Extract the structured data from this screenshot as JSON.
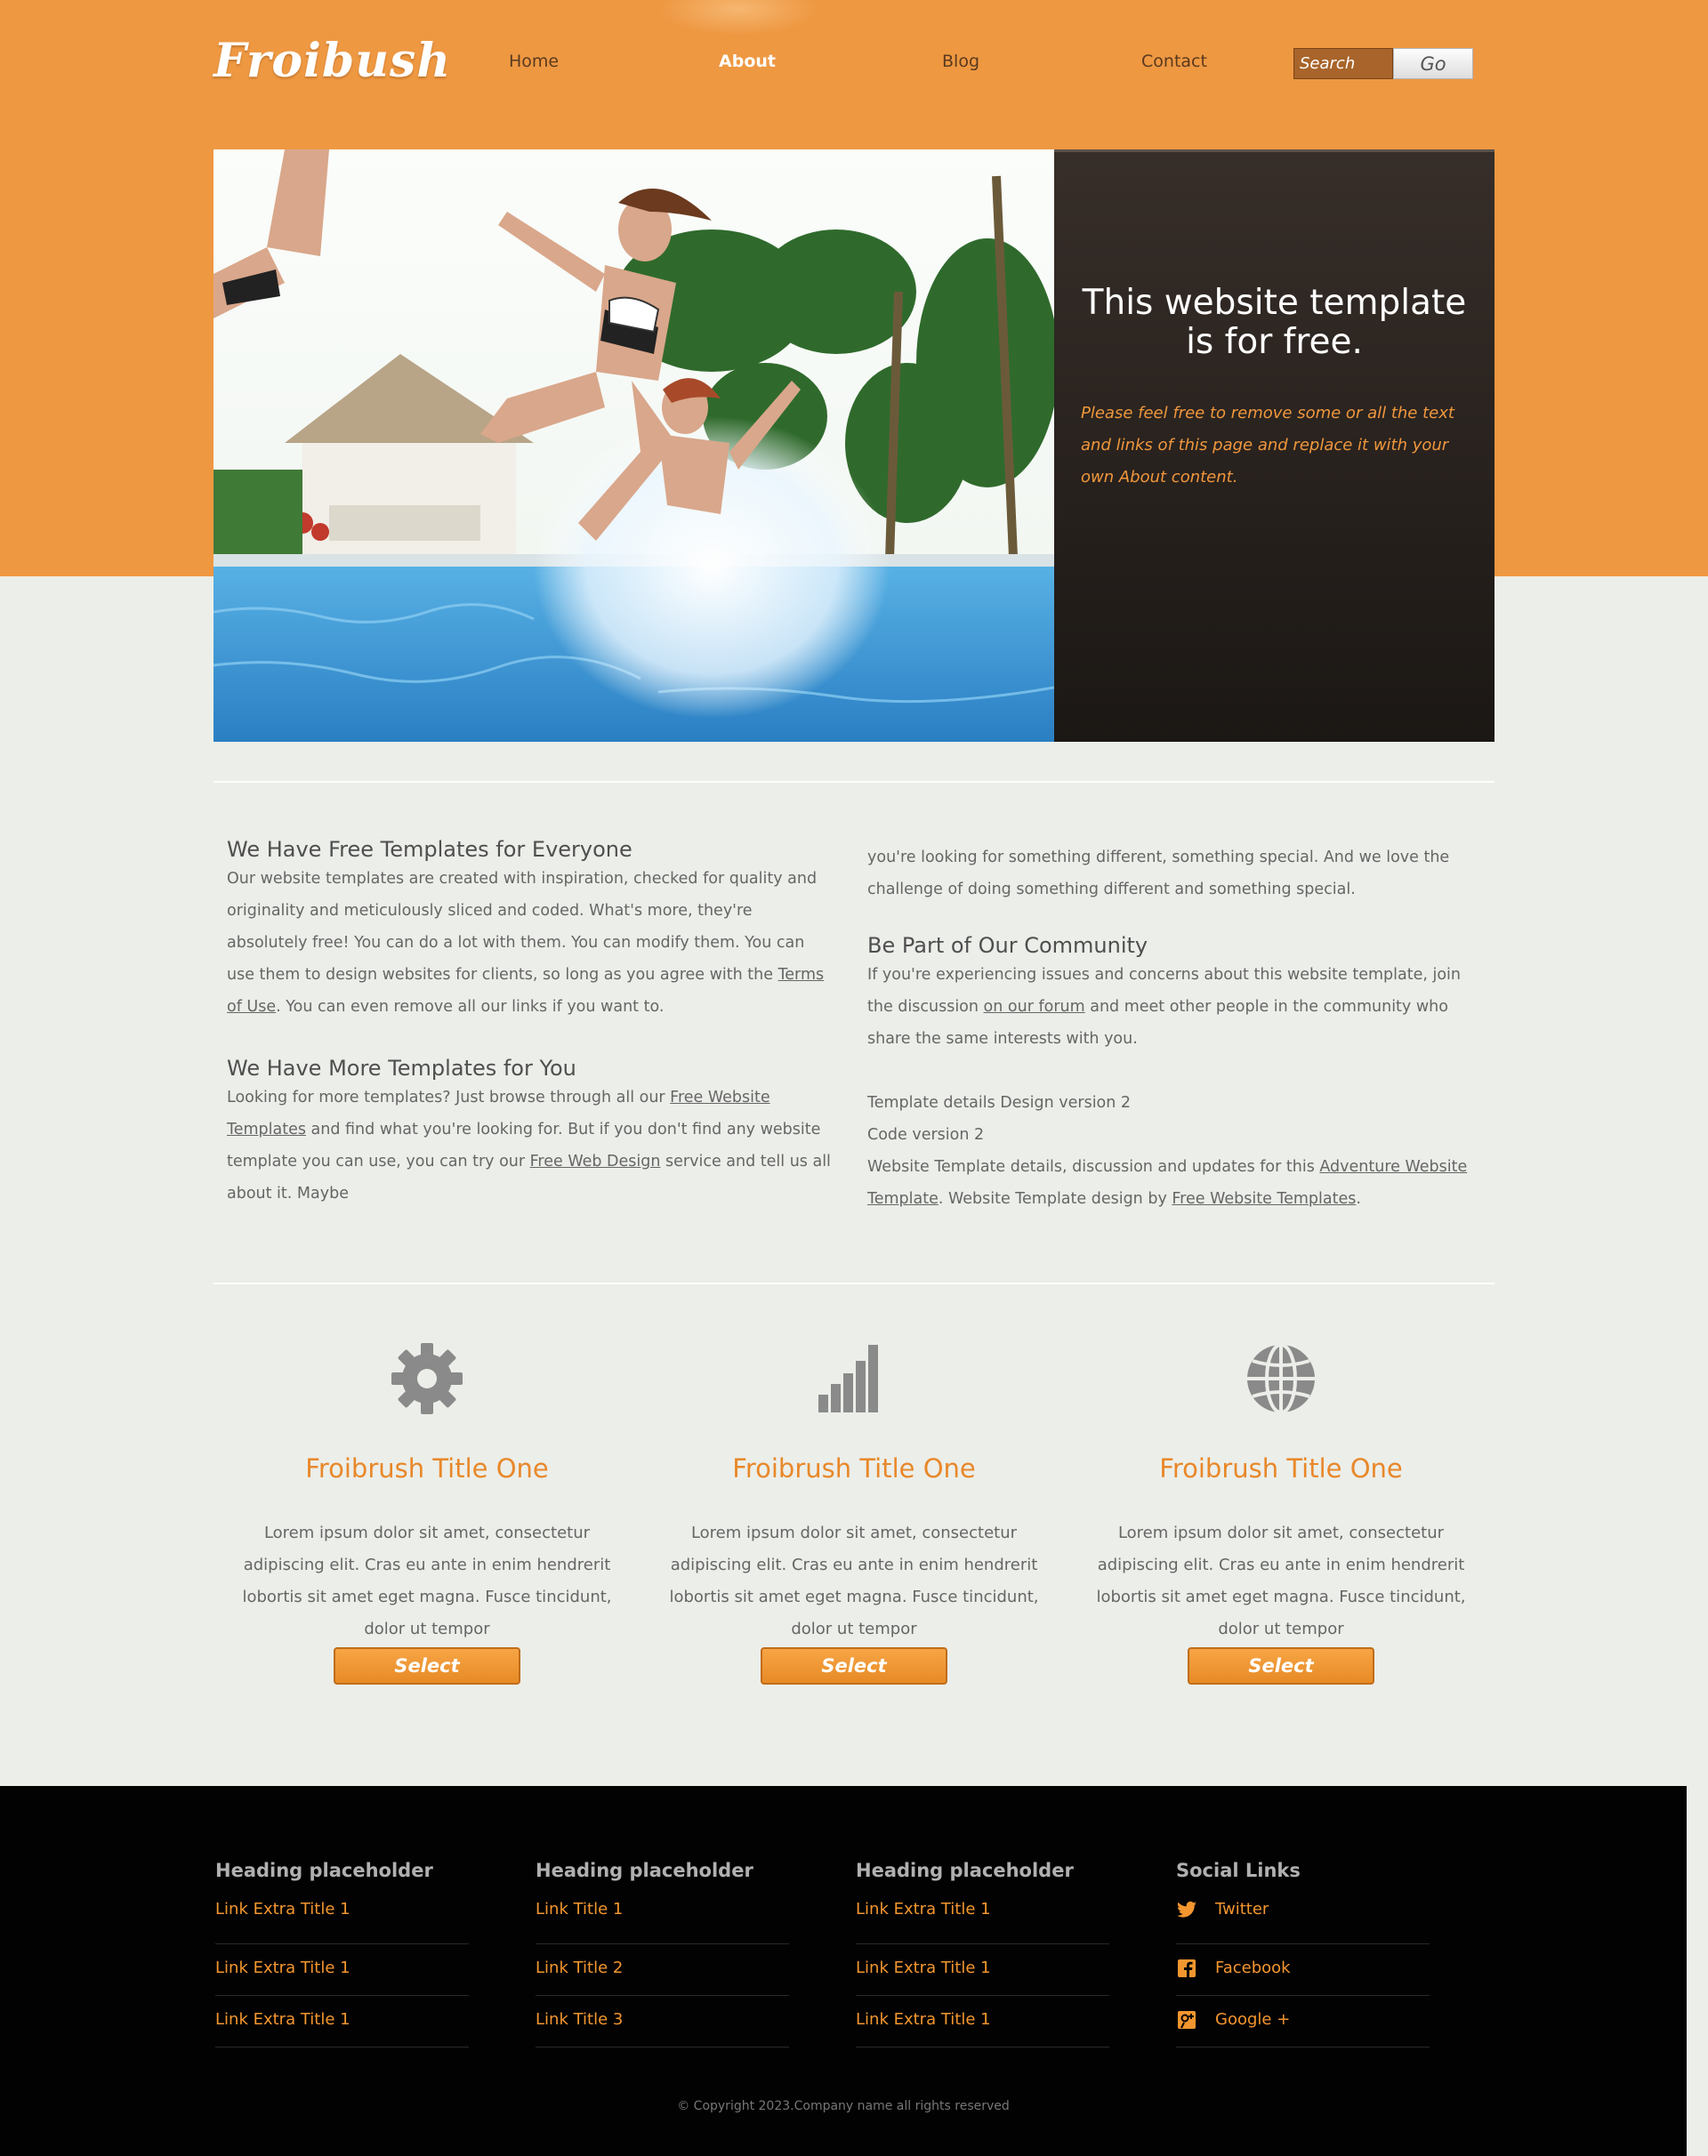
{
  "header": {
    "logo": "Froibush",
    "nav": [
      "Home",
      "About",
      "Blog",
      "Contact"
    ],
    "active_nav": "About",
    "search_placeholder": "Search",
    "search_button": "Go"
  },
  "hero": {
    "title": "This website template is for free.",
    "text": "Please feel free to remove some or all the text and links of this page and replace it with your own About content."
  },
  "content": {
    "left": {
      "h1": "We Have Free Templates for Everyone",
      "p1_a": "Our website templates are created with inspiration, checked for quality and originality and meticulously sliced and coded. What's more, they're absolutely free! You can do a lot with them. You can modify them. You can use them to design websites for clients, so long as you agree with the ",
      "p1_link": "Terms of Use",
      "p1_b": ". You can even remove all our links if you want to.",
      "h2": "We Have More Templates for You",
      "p2_a": "Looking for more templates? Just browse through all our ",
      "p2_link1": "Free Website Templates",
      "p2_b": " and find what you're looking for. But if you don't find any website template you can use, you can try our ",
      "p2_link2": "Free Web Design",
      "p2_c": " service and tell us all about it. Maybe"
    },
    "right": {
      "p0": "you're looking for something different, something special. And we love the challenge of doing something different and something special.",
      "h3": "Be Part of Our Community",
      "p3_a": "If you're experiencing issues and concerns about this website template, join the discussion ",
      "p3_link": "on our forum",
      "p3_b": " and meet other people in the community who share the same interests with you.",
      "d1": "Template details Design version 2",
      "d2": "Code version 2",
      "d3_a": "Website Template details, discussion and updates for this ",
      "d3_link1": "Adventure Website Template",
      "d3_b": ". Website Template design by ",
      "d3_link2": "Free Website Templates",
      "d3_c": "."
    }
  },
  "features": [
    {
      "icon": "gear-icon",
      "title": "Froibrush Title One",
      "text": "Lorem ipsum dolor sit amet, consectetur adipiscing elit. Cras eu ante in enim hendrerit lobortis sit amet eget magna. Fusce tincidunt, dolor ut tempor",
      "button": "Select"
    },
    {
      "icon": "signal-bars-icon",
      "title": "Froibrush Title One",
      "text": "Lorem ipsum dolor sit amet, consectetur adipiscing elit. Cras eu ante in enim hendrerit lobortis sit amet eget magna. Fusce tincidunt, dolor ut tempor",
      "button": "Select"
    },
    {
      "icon": "globe-icon",
      "title": "Froibrush Title One",
      "text": "Lorem ipsum dolor sit amet, consectetur adipiscing elit. Cras eu ante in enim hendrerit lobortis sit amet eget magna. Fusce tincidunt, dolor ut tempor",
      "button": "Select"
    }
  ],
  "footer": {
    "columns": [
      {
        "heading": "Heading placeholder",
        "links": [
          "Link Extra Title 1",
          "Link Extra Title 1",
          "Link Extra Title 1"
        ]
      },
      {
        "heading": "Heading placeholder",
        "links": [
          "Link Title 1",
          "Link Title 2",
          "Link Title 3"
        ]
      },
      {
        "heading": "Heading placeholder",
        "links": [
          "Link Extra Title 1",
          "Link Extra Title 1",
          "Link Extra Title 1"
        ]
      }
    ],
    "social": {
      "heading": "Social Links",
      "links": [
        {
          "icon": "twitter-icon",
          "label": "Twitter"
        },
        {
          "icon": "facebook-icon",
          "label": "Facebook"
        },
        {
          "icon": "google-plus-icon",
          "label": "Google +"
        }
      ]
    },
    "copyright": "© Copyright 2023.Company name all rights reserved"
  },
  "colors": {
    "orange": "#ee9842",
    "accent_text": "#f0973d",
    "feature_title": "#e8882a",
    "footer_bg": "#020202",
    "hero_panel": "#2b2420"
  }
}
